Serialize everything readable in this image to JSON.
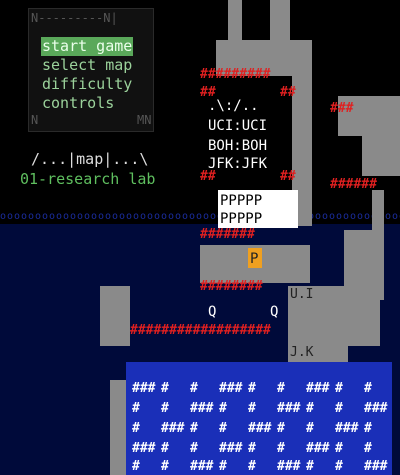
{
  "menu": {
    "items": [
      "start game",
      "select map",
      "difficulty",
      "controls"
    ],
    "selected_index": 0,
    "frame_top": "N---------N|",
    "frame_left_bottom": "N",
    "frame_right_bottom": "MN"
  },
  "map_title": "/...|map|...\\",
  "map_name": "01-research lab",
  "colors": {
    "wall": "#8a8a8a",
    "wall_text": "#222222",
    "brick": "#e02020",
    "water": "#1a2c9c",
    "floor_blue": "#1a2fb8",
    "menu_selected": "#5aa85a",
    "menu_text": "#9bd29b",
    "map_name": "#5fbf5f",
    "player": "#f0a020",
    "highlight": "#ffffff"
  },
  "labels": {
    "lab_rows": [
      ".\\:/..",
      "UCI:UCI",
      "BOH:BOH",
      "JFK:JFK"
    ],
    "ppp_rows": [
      "PPPPP",
      "PPPPP"
    ],
    "player_glyph": "P",
    "door_glyph": "|",
    "q_glyph": "Q",
    "ui_glyph": "U.I",
    "jk_glyph": "J.K"
  }
}
